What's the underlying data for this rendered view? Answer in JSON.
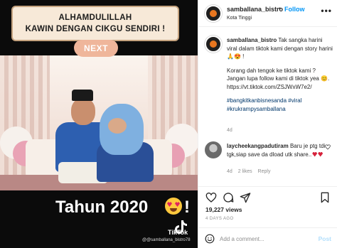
{
  "media": {
    "banner_line1": "ALHAMDULILLAH",
    "banner_line2": "KAWIN DENGAN CIKGU SENDIRI !",
    "next_label": "NEXT",
    "year_text": "Tahun 2020",
    "year_mark": "!",
    "tiktok_label": "TikTok",
    "watermark": "@samballana_bistro78"
  },
  "header": {
    "username": "samballana_bistro",
    "dot": "•",
    "follow_label": "Follow",
    "location": "Kota Tinggi",
    "more_label": "•••"
  },
  "post": {
    "username": "samballana_bistro",
    "line1": "Tak sangka harini viral dalam tiktok kami dengan story harini",
    "line1_emoji": "🙏😍 !",
    "line2": "Korang dah tengok ke tiktok kami ? Jangan lupa follow kami di tiktok yea",
    "line2_emoji": "😊.",
    "link": "https://vt.tiktok.com/ZSJWxW7e2/",
    "hashtags": "#bangkitkanbisnesanda #viral #krukrampysamballana",
    "time": "4d"
  },
  "comment": {
    "username": "laycheekangpadutiram",
    "text": "Baru je ptg tdi tgk,siap save da dload utk share..",
    "time": "4d",
    "likes": "2 likes",
    "reply": "Reply"
  },
  "stats": {
    "likes": "19,227 views",
    "posted": "4 DAYS AGO"
  },
  "composer": {
    "placeholder": "Add a comment...",
    "post_label": "Post"
  },
  "colors": {
    "follow": "#0095f6",
    "post_disabled": "#b2dffc",
    "muted": "#8e8e8e"
  }
}
